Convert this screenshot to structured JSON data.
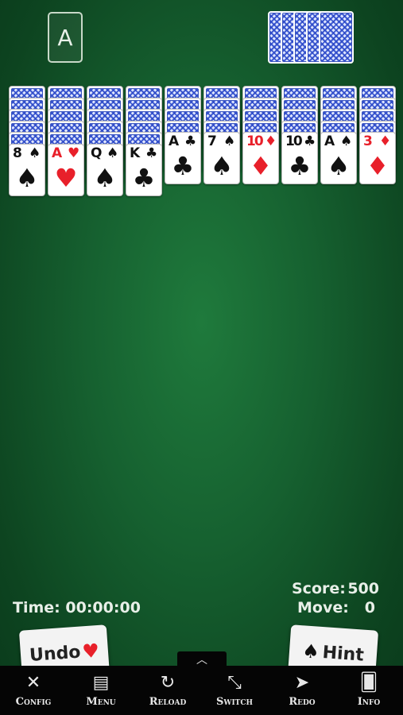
{
  "foundation": {
    "label": "A"
  },
  "stock": {
    "piles": 5
  },
  "columns": [
    {
      "facedown": 5,
      "top": {
        "rank": "8",
        "suit": "♠",
        "color": "black"
      }
    },
    {
      "facedown": 5,
      "top": {
        "rank": "A",
        "suit": "♥",
        "color": "red"
      }
    },
    {
      "facedown": 5,
      "top": {
        "rank": "Q",
        "suit": "♠",
        "color": "black"
      }
    },
    {
      "facedown": 5,
      "top": {
        "rank": "K",
        "suit": "♣",
        "color": "black"
      }
    },
    {
      "facedown": 4,
      "top": {
        "rank": "A",
        "suit": "♣",
        "color": "black"
      }
    },
    {
      "facedown": 4,
      "top": {
        "rank": "7",
        "suit": "♠",
        "color": "black"
      }
    },
    {
      "facedown": 4,
      "top": {
        "rank": "10",
        "suit": "♦",
        "color": "red"
      }
    },
    {
      "facedown": 4,
      "top": {
        "rank": "10",
        "suit": "♣",
        "color": "black"
      }
    },
    {
      "facedown": 4,
      "top": {
        "rank": "A",
        "suit": "♠",
        "color": "black"
      }
    },
    {
      "facedown": 4,
      "top": {
        "rank": "3",
        "suit": "♦",
        "color": "red"
      }
    }
  ],
  "stats": {
    "time_label": "Time:",
    "time_value": "00:00:00",
    "score_label": "Score:",
    "score_value": "500",
    "move_label": "Move:",
    "move_value": "0"
  },
  "buttons": {
    "undo": "Undo",
    "undo_suit": "♥",
    "hint": "Hint",
    "hint_suit": "♠"
  },
  "toolbar": {
    "handle_icon": "chevron-up-icon",
    "items": [
      {
        "label": "Config",
        "icon": "tools-icon"
      },
      {
        "label": "Menu",
        "icon": "document-icon"
      },
      {
        "label": "Reload",
        "icon": "reload-icon"
      },
      {
        "label": "Switch",
        "icon": "expand-icon"
      },
      {
        "label": "Redo",
        "icon": "redo-icon"
      },
      {
        "label": "Info",
        "icon": "card-info-icon"
      }
    ]
  },
  "colors": {
    "felt": "#166130",
    "red_suit": "#e8202a",
    "toolbar": "#050505"
  }
}
